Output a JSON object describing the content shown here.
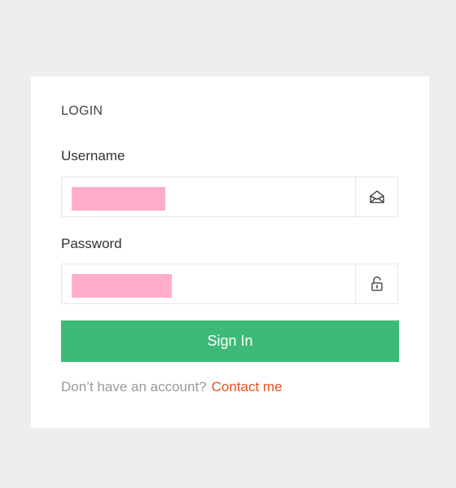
{
  "login": {
    "title": "LOGIN",
    "username_label": "Username",
    "password_label": "Password",
    "username_value": "",
    "password_value": "",
    "username_icon": "envelope-icon",
    "password_icon": "lock-icon",
    "signin_label": "Sign In",
    "no_account_text": "Don’t have an account?",
    "contact_link": "Contact me"
  },
  "colors": {
    "background": "#eeeeee",
    "card": "#ffffff",
    "primary": "#3dba77",
    "link": "#e8501e",
    "redaction": "#ffadcb"
  }
}
